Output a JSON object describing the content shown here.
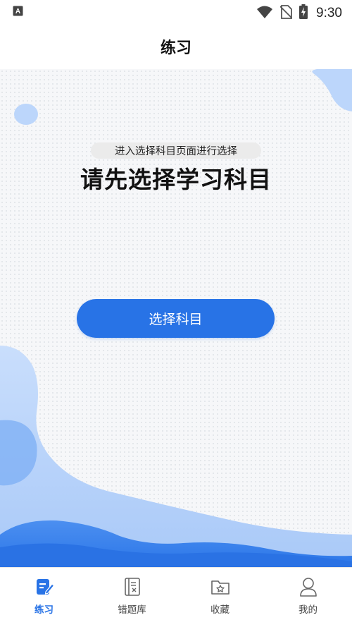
{
  "status_bar": {
    "time": "9:30",
    "icons": [
      "app-a-icon",
      "wifi-icon",
      "no-sim-icon",
      "battery-charging-icon"
    ]
  },
  "header": {
    "title": "练习"
  },
  "main": {
    "heading": "请先选择学习科目",
    "subtitle": "进入选择科目页面进行选择",
    "button_label": "选择科目"
  },
  "bottom_nav": {
    "items": [
      {
        "label": "练习",
        "icon": "edit-note-icon",
        "active": true
      },
      {
        "label": "错题库",
        "icon": "wrong-book-icon",
        "active": false
      },
      {
        "label": "收藏",
        "icon": "folder-star-icon",
        "active": false
      },
      {
        "label": "我的",
        "icon": "user-icon",
        "active": false
      }
    ]
  },
  "colors": {
    "accent": "#2873e6",
    "wave_light": "#bcd6fb",
    "wave_mid": "#7fb0f5"
  }
}
